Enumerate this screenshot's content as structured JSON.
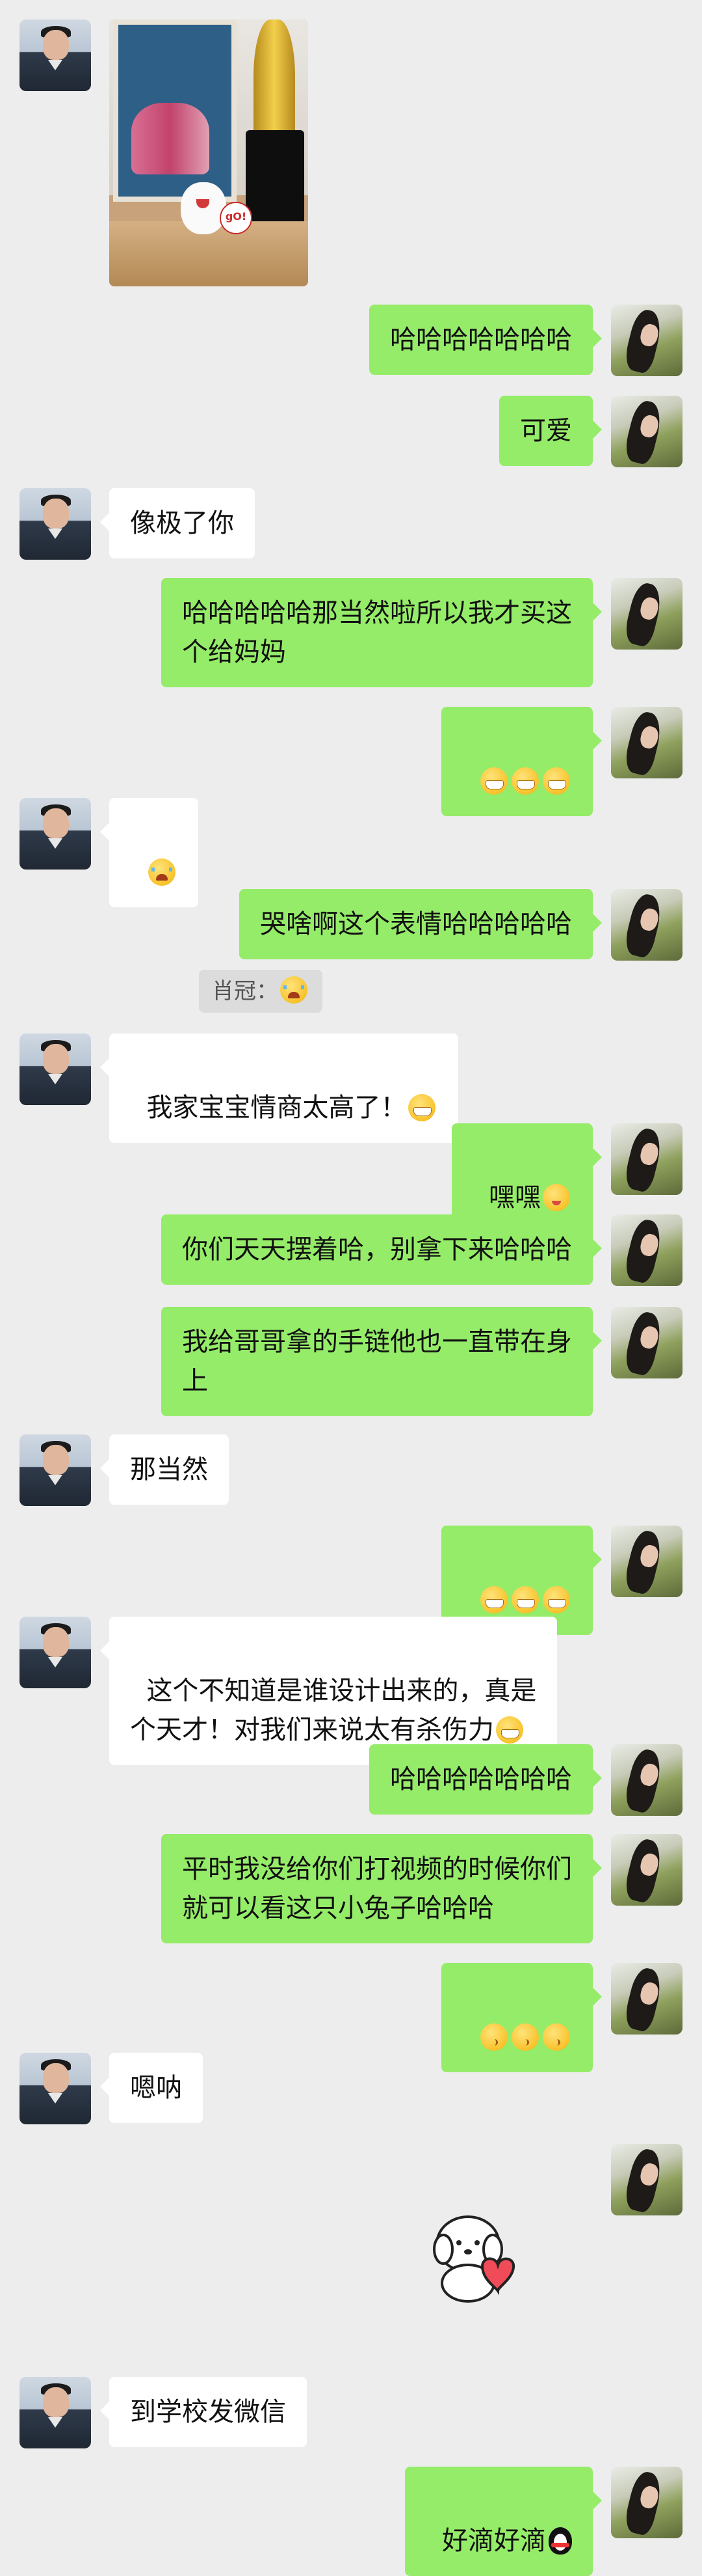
{
  "messages": [
    {
      "side": "left",
      "text": ""
    },
    {
      "side": "right",
      "text": "哈哈哈哈哈哈哈"
    },
    {
      "side": "right",
      "text": "可爱"
    },
    {
      "side": "left",
      "text": "像极了你"
    },
    {
      "side": "right",
      "text": "哈哈哈哈哈那当然啦所以我才买这\n个给妈妈"
    },
    {
      "side": "right",
      "text": "",
      "emoji": [
        "grin",
        "grin",
        "grin"
      ]
    },
    {
      "side": "left",
      "text": "",
      "emoji": [
        "cry"
      ]
    },
    {
      "side": "right",
      "text": "哭啥啊这个表情哈哈哈哈哈"
    },
    {
      "side": "quote",
      "text": "肖冠："
    },
    {
      "side": "left",
      "text": "我家宝宝情商太高了！"
    },
    {
      "side": "right",
      "text": "嘿嘿"
    },
    {
      "side": "right",
      "text": "你们天天摆着哈，别拿下来哈哈哈"
    },
    {
      "side": "right",
      "text": "我给哥哥拿的手链他也一直带在身\n上"
    },
    {
      "side": "left",
      "text": "那当然"
    },
    {
      "side": "right",
      "text": "",
      "emoji": [
        "grin",
        "grin",
        "grin"
      ]
    },
    {
      "side": "left",
      "text": "这个不知道是谁设计出来的，真是\n个天才！对我们来说太有杀伤力"
    },
    {
      "side": "right",
      "text": "哈哈哈哈哈哈哈"
    },
    {
      "side": "right",
      "text": "平时我没给你们打视频的时候你们\n就可以看这只小兔子哈哈哈"
    },
    {
      "side": "right",
      "text": "",
      "emoji": [
        "kiss",
        "kiss",
        "kiss"
      ]
    },
    {
      "side": "left",
      "text": "嗯呐"
    },
    {
      "side": "left",
      "text": "到学校发微信"
    },
    {
      "side": "right",
      "text": "好滴好滴"
    }
  ],
  "photo_sign": "gO!",
  "sticker": "dog-heart-sticker",
  "colors": {
    "background": "#ededed",
    "bubble_mine": "#95ec69",
    "bubble_theirs": "#ffffff",
    "quote_bg": "#dcdcdc"
  }
}
